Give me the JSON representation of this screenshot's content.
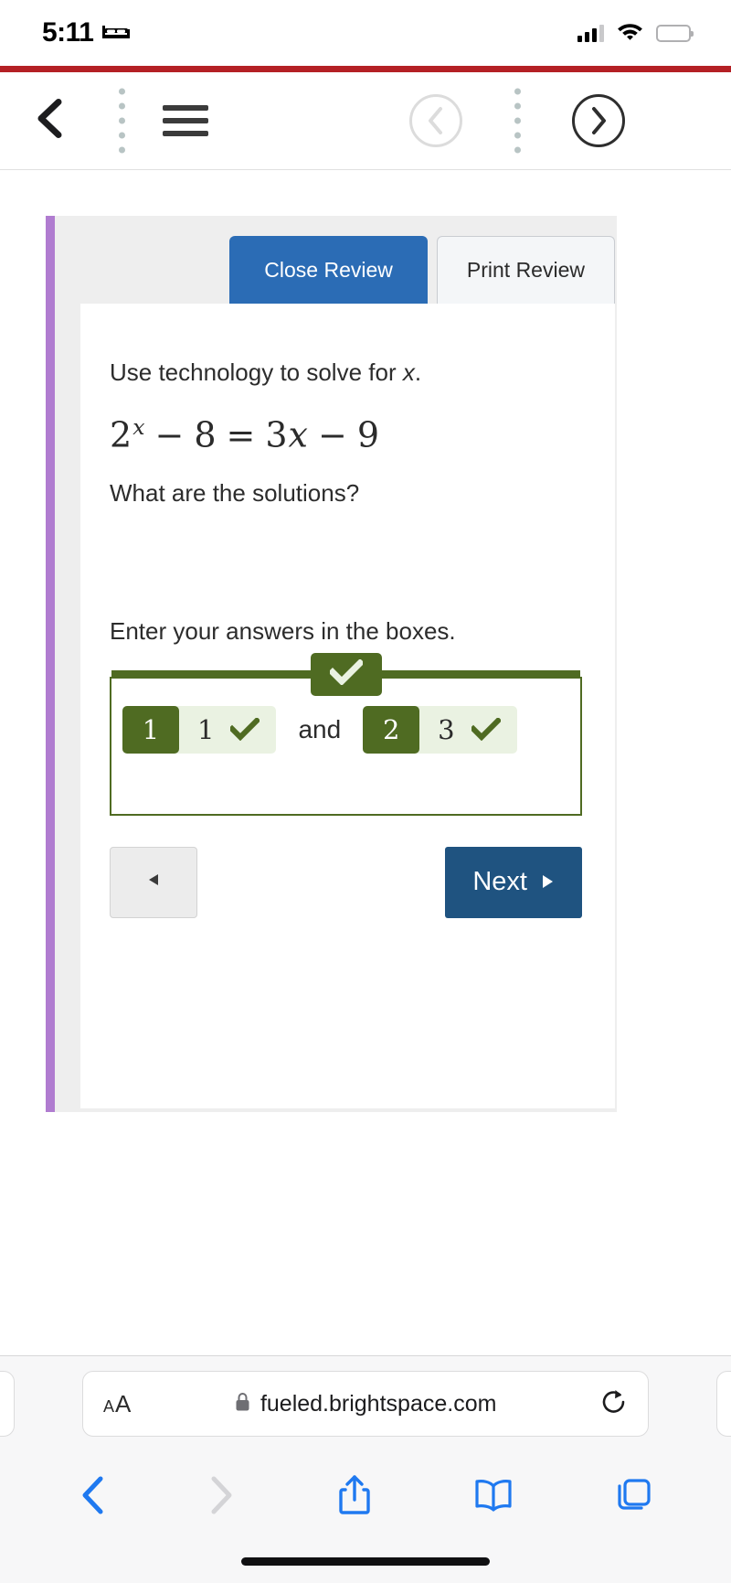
{
  "status_bar": {
    "time": "5:11",
    "sleep_icon": "bed-icon",
    "signal_icon": "cellular-signal-icon",
    "signal_bars_filled": 3,
    "signal_bars_total": 4,
    "wifi_icon": "wifi-icon",
    "battery_icon": "battery-low-icon",
    "battery_color": "#f03e34"
  },
  "app_bar": {
    "back_icon": "chevron-left-icon",
    "menu_icon": "hamburger-menu-icon",
    "prev_icon": "circled-chevron-left-icon",
    "next_icon": "circled-chevron-right-icon",
    "prev_enabled": false,
    "next_enabled": true,
    "separator_icon": "vertical-dotted-divider-icon",
    "accent_color": "#b42025"
  },
  "quiz": {
    "accent_bar_color": "#b07cd0",
    "close_review_label": "Close Review",
    "print_review_label": "Print Review",
    "prompt_before": "Use technology to solve for ",
    "prompt_variable": "x",
    "prompt_after": ".",
    "equation": {
      "base": "2",
      "exponent": "x",
      "minus1": "−",
      "term1": "8",
      "equals": "=",
      "coefficient": "3",
      "variable": "x",
      "minus2": "−",
      "term2": "9",
      "full": "2^x − 8 = 3x − 9"
    },
    "sub_question": "What are the solutions?",
    "instruction": "Enter your answers in the boxes.",
    "graded_correct": true,
    "correct_color": "#4f6b22",
    "correct_fill": "#eaf2e2",
    "header_check_icon": "check-mark-icon",
    "answers": [
      {
        "index": "1",
        "value": "1",
        "check_icon": "check-mark-icon"
      },
      {
        "index": "2",
        "value": "3",
        "check_icon": "check-mark-icon"
      }
    ],
    "conjunction": "and",
    "prev_question_icon": "triangle-left-icon",
    "next_question_label": "Next",
    "next_question_icon": "triangle-right-icon",
    "next_button_color": "#1f5380"
  },
  "browser": {
    "text_size_small": "A",
    "text_size_large": "A",
    "lock_icon": "lock-icon",
    "url": "fueled.brightspace.com",
    "reload_icon": "reload-icon",
    "back_icon": "chevron-left-icon",
    "forward_icon": "chevron-right-icon",
    "share_icon": "share-icon",
    "bookmarks_icon": "book-icon",
    "tabs_icon": "tabs-icon",
    "back_enabled": true,
    "forward_enabled": false,
    "tint_color": "#1f79f0"
  }
}
